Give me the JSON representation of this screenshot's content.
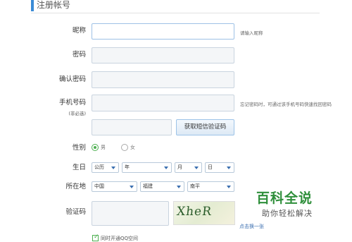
{
  "section": {
    "title": "注册帐号"
  },
  "nickname": {
    "label": "昵称",
    "hint": "请输入昵称",
    "value": ""
  },
  "password": {
    "label": "密码",
    "value": ""
  },
  "confirm_password": {
    "label": "确认密码",
    "value": ""
  },
  "phone": {
    "label": "手机号码",
    "sublabel": "(非必选)",
    "hint": "忘记密码时，可通过该手机号码快速找回密码",
    "value": ""
  },
  "sms": {
    "code_value": "",
    "button_label": "获取短信验证码"
  },
  "gender": {
    "label": "性别",
    "options": [
      "男",
      "女"
    ],
    "selected": "男"
  },
  "birthday": {
    "label": "生日",
    "calendar": "公历",
    "year": "年",
    "month": "月",
    "day": "日"
  },
  "location": {
    "label": "所在地",
    "country": "中国",
    "province": "福建",
    "city": "南平"
  },
  "captcha": {
    "label": "验证码",
    "value": "",
    "image_text": "XheR",
    "refresh_label": "点击换一张"
  },
  "qzone": {
    "label": "同时开通QQ空间",
    "checked": true
  },
  "watermark": {
    "title": "百科全说",
    "subtitle": "助你轻松解决"
  },
  "colors": {
    "accent": "#3b8bd6",
    "radio_selected": "#4caf50",
    "watermark": "#2f8f3b"
  }
}
